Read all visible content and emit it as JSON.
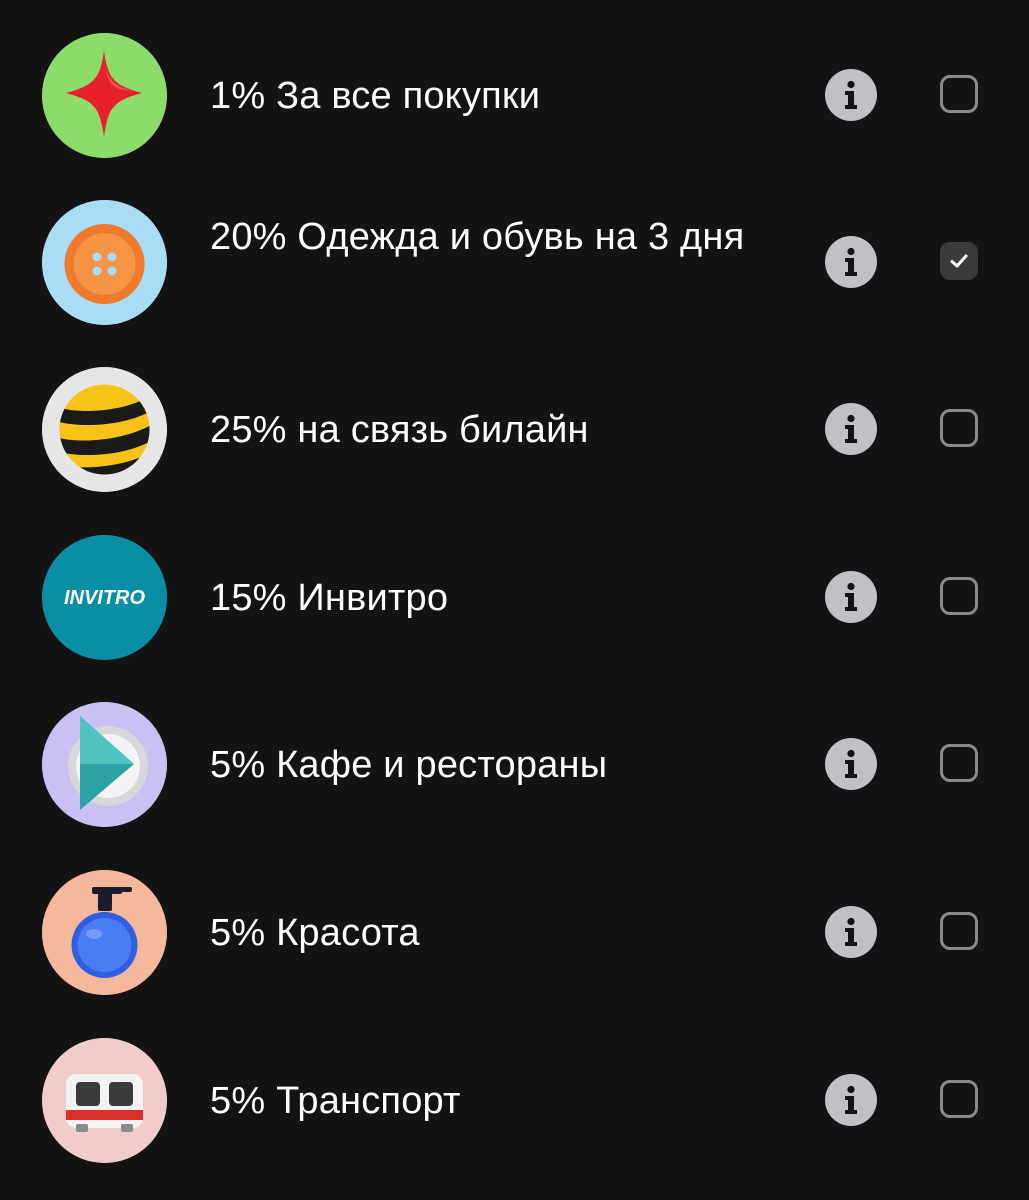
{
  "offers": [
    {
      "label": "1% За все покупки",
      "icon": "red-star-icon",
      "avatar_bg": "#8ddb6b",
      "checked": false
    },
    {
      "label": "20% Одежда и обувь на 3 дня",
      "icon": "orange-button-icon",
      "avatar_bg": "#a9ddf5",
      "checked": true
    },
    {
      "label": "25% на связь билайн",
      "icon": "beeline-logo-icon",
      "avatar_bg": "#e6e6e6",
      "checked": false
    },
    {
      "label": "15% Инвитро",
      "icon": "invitro-logo",
      "logo_text": "INVITRO",
      "avatar_bg": "#0a8ea6",
      "checked": false
    },
    {
      "label": "5% Кафе и рестораны",
      "icon": "plate-icon",
      "avatar_bg": "#c9c0f3",
      "checked": false
    },
    {
      "label": "5% Красота",
      "icon": "soap-bottle-icon",
      "avatar_bg": "#f6b89c",
      "checked": false
    },
    {
      "label": "5% Транспорт",
      "icon": "train-icon",
      "avatar_bg": "#f0cdcb",
      "checked": false
    }
  ],
  "colors": {
    "background": "#131313",
    "text": "#ffffff",
    "info_button": "#bfc1c6",
    "checkbox_border": "#8a8a8e",
    "checkbox_checked": "#3a3a3c"
  }
}
